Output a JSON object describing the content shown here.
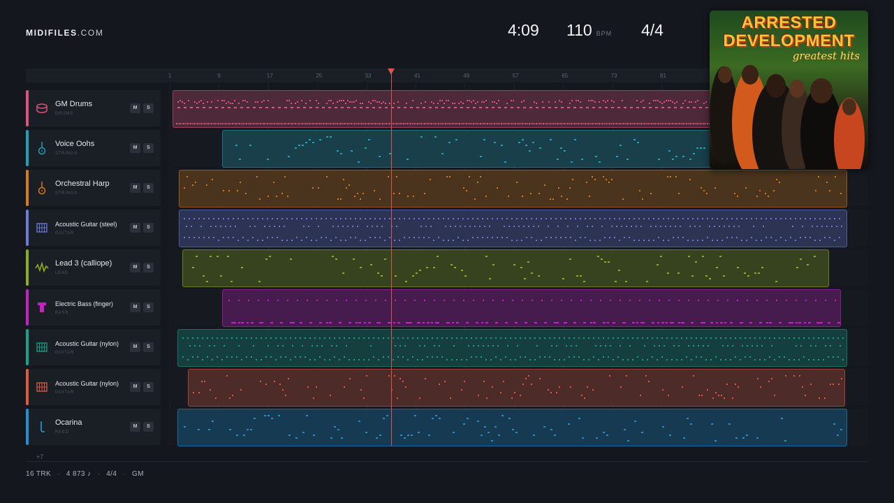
{
  "header": {
    "brand_bold": "MIDIFILES",
    "brand_light": ".COM",
    "duration": "4:09",
    "tempo": "110",
    "tempo_unit": "BPM",
    "time_signature": "4/4"
  },
  "ruler": {
    "bars": [
      "1",
      "9",
      "17",
      "25",
      "33",
      "41",
      "49",
      "57",
      "65",
      "73",
      "81"
    ]
  },
  "playhead": {
    "bar": 37
  },
  "tracks": [
    {
      "name": "GM Drums",
      "category": "DRUMS",
      "color": "#e0527a",
      "icon": "drum-icon",
      "mute": "M",
      "solo": "S",
      "clip_start_bar": 1.5,
      "clip_end_bar": 111,
      "pattern": "drums"
    },
    {
      "name": "Voice Oohs",
      "category": "STRINGS",
      "color": "#1fa2b8",
      "icon": "guitar-icon",
      "mute": "M",
      "solo": "S",
      "clip_start_bar": 9.5,
      "clip_end_bar": 111,
      "pattern": "melody"
    },
    {
      "name": "Orchestral Harp",
      "category": "STRINGS",
      "color": "#d57b17",
      "icon": "guitar-icon",
      "mute": "M",
      "solo": "S",
      "clip_start_bar": 2.5,
      "clip_end_bar": 111,
      "pattern": "scatter"
    },
    {
      "name": "Acoustic Guitar (steel)",
      "category": "GUITAR",
      "color": "#6c7ad8",
      "icon": "grid-icon",
      "mute": "M",
      "solo": "S",
      "clip_start_bar": 2.5,
      "clip_end_bar": 111,
      "pattern": "dots"
    },
    {
      "name": "Lead 3 (calliope)",
      "category": "LEAD",
      "color": "#8fae1c",
      "icon": "wave-icon",
      "mute": "M",
      "solo": "S",
      "clip_start_bar": 3,
      "clip_end_bar": 108,
      "pattern": "melody"
    },
    {
      "name": "Electric Bass (finger)",
      "category": "BASS",
      "color": "#c323c3",
      "icon": "bass-icon",
      "mute": "M",
      "solo": "S",
      "clip_start_bar": 9.5,
      "clip_end_bar": 110,
      "pattern": "bass"
    },
    {
      "name": "Acoustic Guitar (nylon)",
      "category": "GUITAR",
      "color": "#14a38b",
      "icon": "grid-icon",
      "mute": "M",
      "solo": "S",
      "clip_start_bar": 2.3,
      "clip_end_bar": 111,
      "pattern": "dots"
    },
    {
      "name": "Acoustic Guitar (nylon)",
      "category": "GUITAR",
      "color": "#e05a3e",
      "icon": "grid-icon",
      "mute": "M",
      "solo": "S",
      "clip_start_bar": 4,
      "clip_end_bar": 110.7,
      "pattern": "scatter"
    },
    {
      "name": "Ocarina",
      "category": "REED",
      "color": "#1e90d6",
      "icon": "reed-icon",
      "mute": "M",
      "solo": "S",
      "clip_start_bar": 2.3,
      "clip_end_bar": 111,
      "pattern": "melody"
    }
  ],
  "more_tracks": "+7",
  "footer": {
    "tracks": "16 TRK",
    "notes": "4 873 ♪",
    "signature": "4/4",
    "standard": "GM"
  },
  "album": {
    "title_line1": "ARRESTED",
    "title_line2": "DEVELOPMENT",
    "subtitle": "greatest hits"
  }
}
